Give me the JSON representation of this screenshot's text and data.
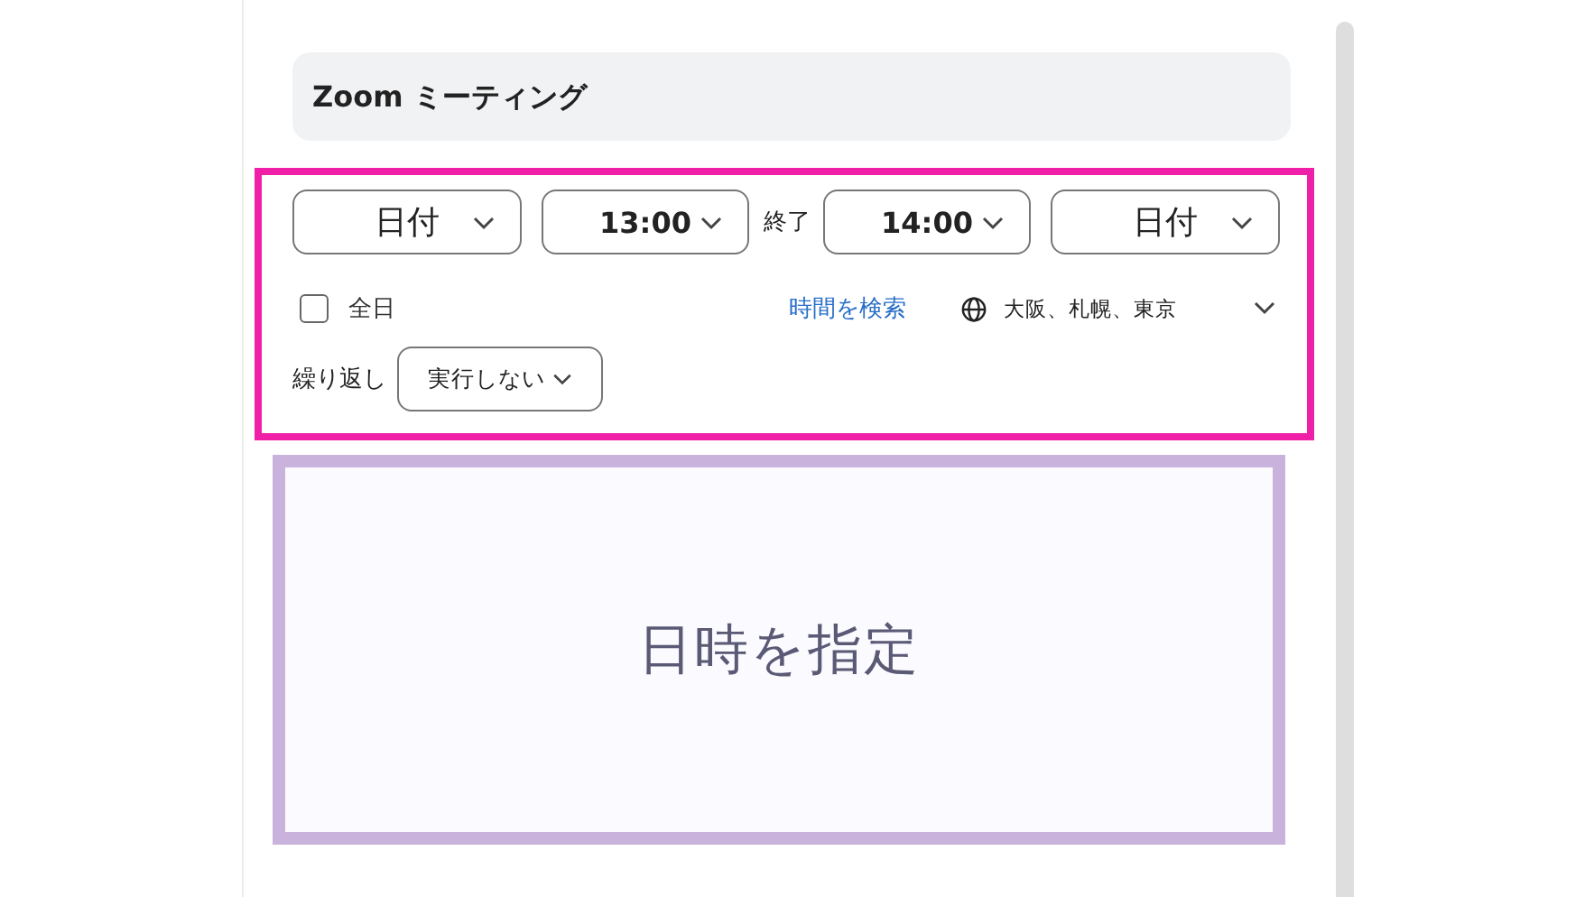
{
  "title_field": {
    "value": "Zoom ミーティング"
  },
  "time_row": {
    "start_date": "日付",
    "start_time": "13:00",
    "end_label": "終了",
    "end_time": "14:00",
    "end_date": "日付"
  },
  "all_day": {
    "label": "全日",
    "checked": false
  },
  "find_time_link": "時間を検索",
  "timezone": "大阪、札幌、東京",
  "repeat": {
    "label": "繰り返し",
    "value": "実行しない"
  },
  "callout": {
    "text": "日時を指定"
  }
}
